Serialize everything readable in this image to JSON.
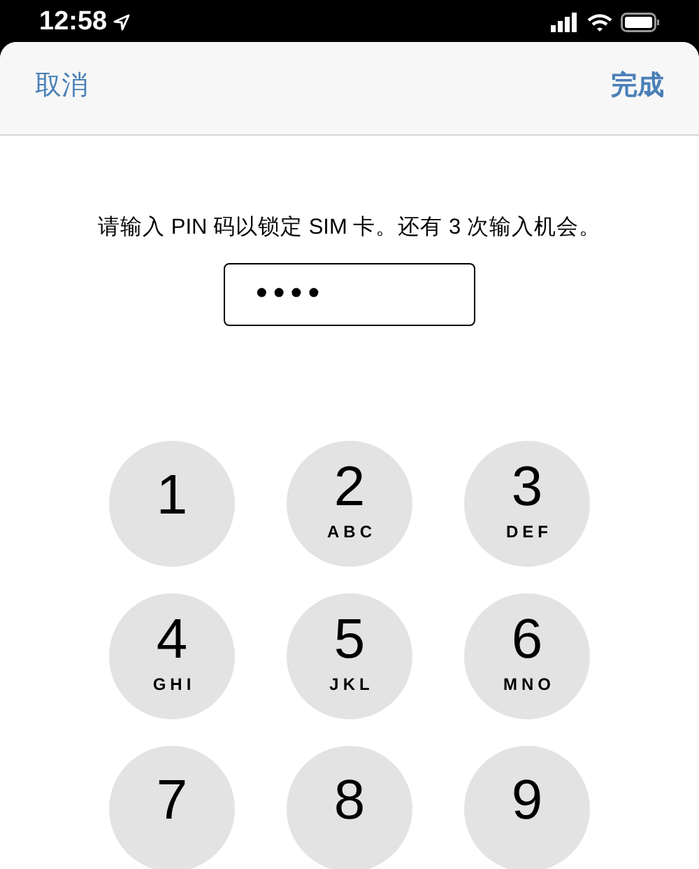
{
  "status_bar": {
    "time": "12:58"
  },
  "nav": {
    "cancel": "取消",
    "done": "完成"
  },
  "prompt": "请输入 PIN 码以锁定 SIM 卡。还有 3 次输入机会。",
  "pin_field": {
    "value": "••••"
  },
  "keypad": [
    {
      "digit": "1"
    },
    {
      "digit": "2",
      "letters": "ABC"
    },
    {
      "digit": "3",
      "letters": "DEF"
    },
    {
      "digit": "4",
      "letters": "GHI"
    },
    {
      "digit": "5",
      "letters": "JKL"
    },
    {
      "digit": "6",
      "letters": "MNO"
    },
    {
      "digit": "7"
    },
    {
      "digit": "8"
    },
    {
      "digit": "9"
    }
  ]
}
